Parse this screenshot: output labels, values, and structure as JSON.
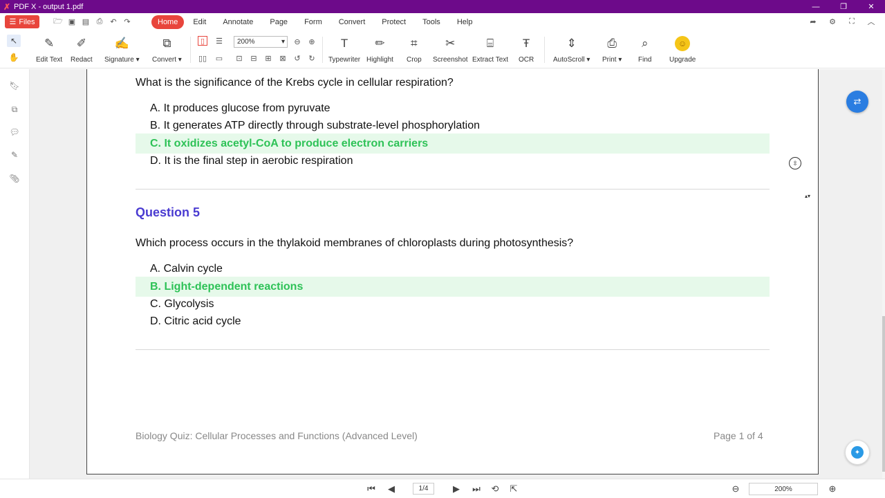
{
  "window": {
    "title": "PDF X - output 1.pdf",
    "controls": [
      "—",
      "❐",
      "✕"
    ]
  },
  "menubar": {
    "files_label": "Files",
    "tabs": [
      "Home",
      "Edit",
      "Annotate",
      "Page",
      "Form",
      "Convert",
      "Protect",
      "Tools",
      "Help"
    ],
    "active_tab": "Home"
  },
  "toolbar": {
    "zoom": "200%",
    "tools": {
      "edit_text": "Edit Text",
      "redact": "Redact",
      "signature": "Signature ▾",
      "convert": "Convert ▾",
      "typewriter": "Typewriter",
      "highlight": "Highlight",
      "crop": "Crop",
      "screenshot": "Screenshot",
      "extract_text": "Extract Text",
      "ocr": "OCR",
      "autoscroll": "AutoScroll ▾",
      "print": "Print ▾",
      "find": "Find",
      "upgrade": "Upgrade"
    }
  },
  "document": {
    "question4": {
      "text": "What is the significance of the Krebs cycle in cellular respiration?",
      "options": [
        "A. It produces glucose from pyruvate",
        "B. It generates ATP directly through substrate-level phosphorylation",
        "C. It oxidizes acetyl-CoA to produce electron carriers",
        "D. It is the final step in aerobic respiration"
      ],
      "correct": "C"
    },
    "question5": {
      "heading": "Question 5",
      "text": "Which process occurs in the thylakoid membranes of chloroplasts during photosynthesis?",
      "options": [
        "A. Calvin cycle",
        "B. Light-dependent reactions",
        "C. Glycolysis",
        "D. Citric acid cycle"
      ],
      "correct": "B"
    },
    "footer_left": "Biology Quiz: Cellular Processes and Functions (Advanced Level)",
    "footer_right": "Page 1 of 4"
  },
  "statusbar": {
    "page_indicator": "1/4",
    "zoom": "200%"
  },
  "colors": {
    "titlebar": "#6d0a8a",
    "accent": "#e8453c",
    "question_heading": "#4a3bd1",
    "correct_text": "#2ec257",
    "correct_bg": "#e6f9ea"
  }
}
